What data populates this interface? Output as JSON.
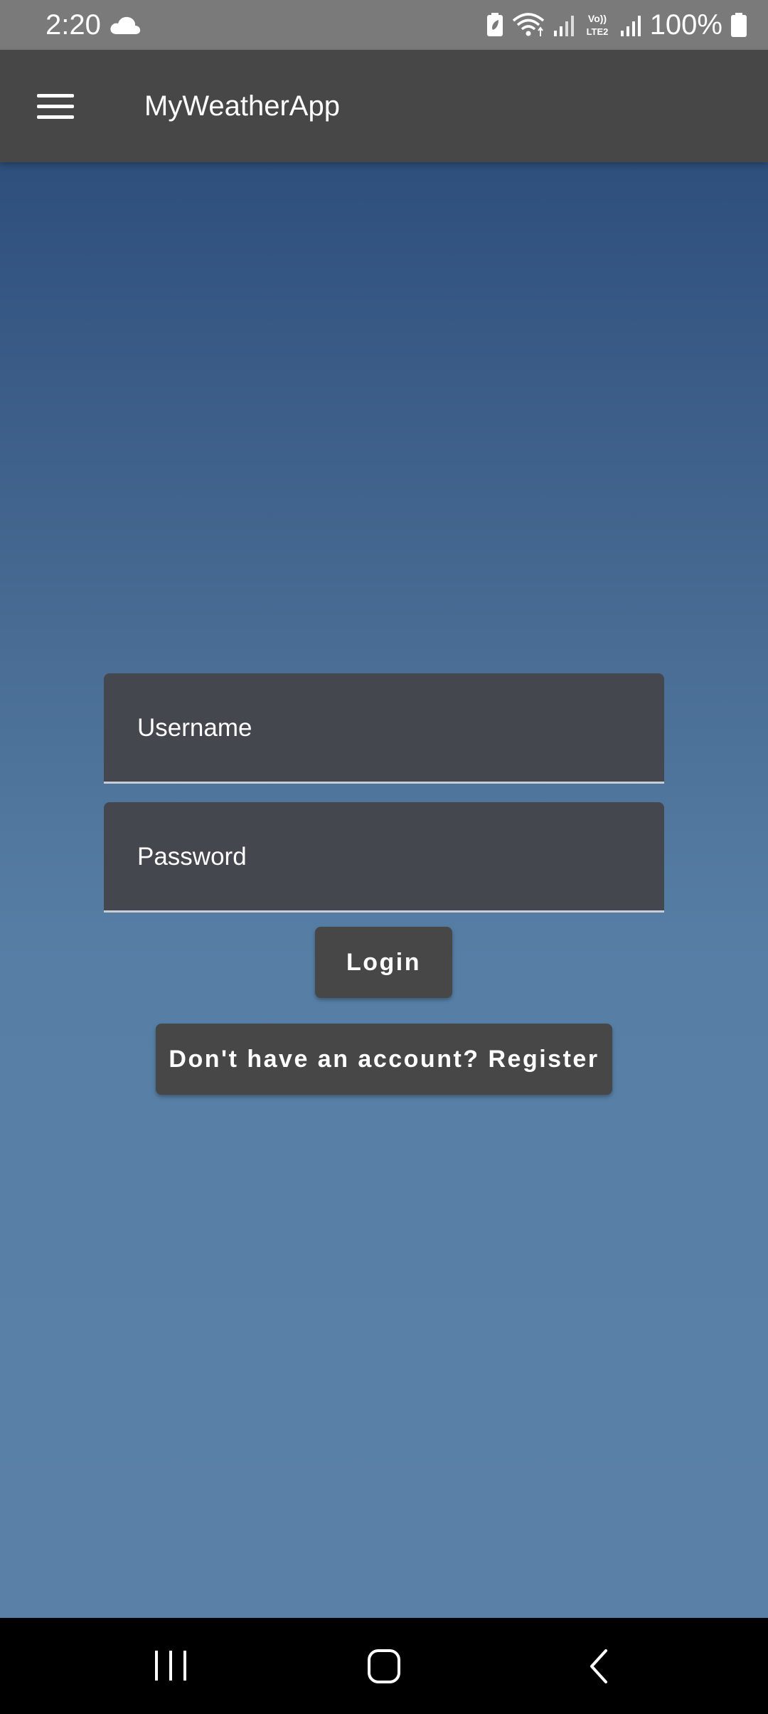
{
  "status_bar": {
    "time": "2:20",
    "battery_text": "100%",
    "icons": [
      "cloud-icon",
      "battery-saver-icon",
      "wifi-icon",
      "signal-icon",
      "volte-lte2-icon",
      "signal-icon",
      "battery-icon"
    ],
    "network_label_top": "Vo))",
    "network_label_bottom": "LTE2"
  },
  "app_bar": {
    "title": "MyWeatherApp",
    "menu_icon": "hamburger-menu-icon"
  },
  "login_form": {
    "username_placeholder": "Username",
    "password_placeholder": "Password",
    "login_label": "Login",
    "register_label": "Don't have an account? Register"
  },
  "nav_bar": {
    "icons": [
      "recents-icon",
      "home-icon",
      "back-icon"
    ]
  },
  "colors": {
    "status_bar": "#7a7a7a",
    "app_bar": "#474747",
    "background_top": "#2e4f7c",
    "background_bottom": "#5a80a7",
    "field_background": "#45474f",
    "button_background": "#474747",
    "nav_bar": "#000000"
  }
}
